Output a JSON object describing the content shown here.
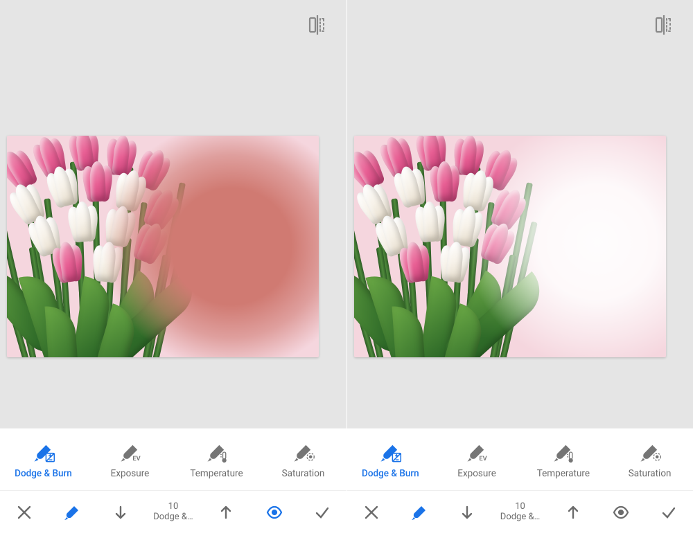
{
  "colors": {
    "accent": "#1a73e8",
    "muted": "#6b6b6b",
    "icon": "#757575",
    "canvas_bg": "#f5d6de",
    "burn_tint": "#d07a72",
    "dodge_tint": "#ffffff",
    "pink_tulip": "#e85f94",
    "pink_tulip_light": "#f2a9c3",
    "white_tulip": "#f7f2e9",
    "white_tulip_shadow": "#e3d9c7"
  },
  "compare_icon_name": "compare-before-after-icon",
  "panels": [
    {
      "effect": "burn",
      "tools": [
        {
          "id": "dodge-burn",
          "label": "Dodge & Burn",
          "active": true
        },
        {
          "id": "exposure",
          "label": "Exposure",
          "active": false
        },
        {
          "id": "temperature",
          "label": "Temperature",
          "active": false
        },
        {
          "id": "saturation",
          "label": "Saturation",
          "active": false
        }
      ],
      "slider": {
        "value": "10",
        "caption": "Dodge &…"
      },
      "eye_active": true
    },
    {
      "effect": "dodge",
      "tools": [
        {
          "id": "dodge-burn",
          "label": "Dodge & Burn",
          "active": true
        },
        {
          "id": "exposure",
          "label": "Exposure",
          "active": false
        },
        {
          "id": "temperature",
          "label": "Temperature",
          "active": false
        },
        {
          "id": "saturation",
          "label": "Saturation",
          "active": false
        }
      ],
      "slider": {
        "value": "10",
        "caption": "Dodge &…"
      },
      "eye_active": false
    }
  ],
  "action_names": {
    "close": "close-button",
    "brush": "brush-tool-button",
    "down": "decrease-value-button",
    "up": "increase-value-button",
    "eye": "toggle-preview-button",
    "confirm": "confirm-button"
  }
}
